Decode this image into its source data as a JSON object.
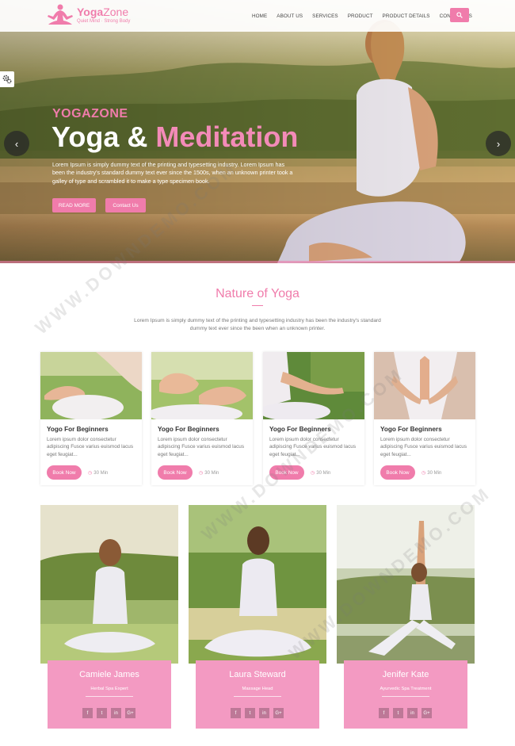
{
  "header": {
    "logo_name": "Yoga",
    "logo_name_2": "Zone",
    "logo_tag": "Quiet Mind · Strong Body",
    "nav": [
      "HOME",
      "ABOUT US",
      "SERVICES",
      "PRODUCT",
      "PRODUCT DETAILS",
      "CONTACT US"
    ],
    "search_icon": "search-icon"
  },
  "hero": {
    "kicker": "YOGAZONE",
    "title_1": "Yoga &",
    "title_2": "Meditation",
    "text": "Lorem Ipsum is simply dummy text of the printing and typesetting industry. Lorem Ipsum has been the industry's standard dummy text ever since the 1500s, when an unknown printer took a galley of type and scrambled it to make a type specimen book.",
    "btn_read": "READ MORE",
    "btn_contact": "Contact Us",
    "prev": "‹",
    "next": "›"
  },
  "nature": {
    "title": "Nature of Yoga",
    "subtitle": "Lorem Ipsum is simply dummy text of the printing and typesetting industry has been the industry's standard dummy text ever since the been when an unknown printer.",
    "cards": [
      {
        "title": "Yogo For Beginners",
        "text": "Lorem ipsum dolor consectetur adipiscing Fusce varius euismod lacus eget feugiat...",
        "btn": "Book Now",
        "time": "30 Min"
      },
      {
        "title": "Yogo For Beginners",
        "text": "Lorem ipsum dolor consectetur adipiscing Fusce varius euismod lacus eget feugiat...",
        "btn": "Book Now",
        "time": "30 Min"
      },
      {
        "title": "Yogo For Beginners",
        "text": "Lorem ipsum dolor consectetur adipiscing Fusce varius euismod lacus eget feugiat...",
        "btn": "Book Now",
        "time": "30 Min"
      },
      {
        "title": "Yogo For Beginners",
        "text": "Lorem ipsum dolor consectetur adipiscing Fusce varius euismod lacus eget feugiat...",
        "btn": "Book Now",
        "time": "30 Min"
      }
    ]
  },
  "team": [
    {
      "name": "Camiele James",
      "role": "Herbal Spa Expert"
    },
    {
      "name": "Laura Steward",
      "role": "Massage Head"
    },
    {
      "name": "Jenifer Kate",
      "role": "Ayurvedic Spa Treatment"
    }
  ],
  "socials": [
    "f",
    "t",
    "in",
    "G+"
  ],
  "watermark": "WWW.DOWNDEMO.COM",
  "colors": {
    "accent": "#f07cab",
    "team_box": "#f39ac2"
  }
}
